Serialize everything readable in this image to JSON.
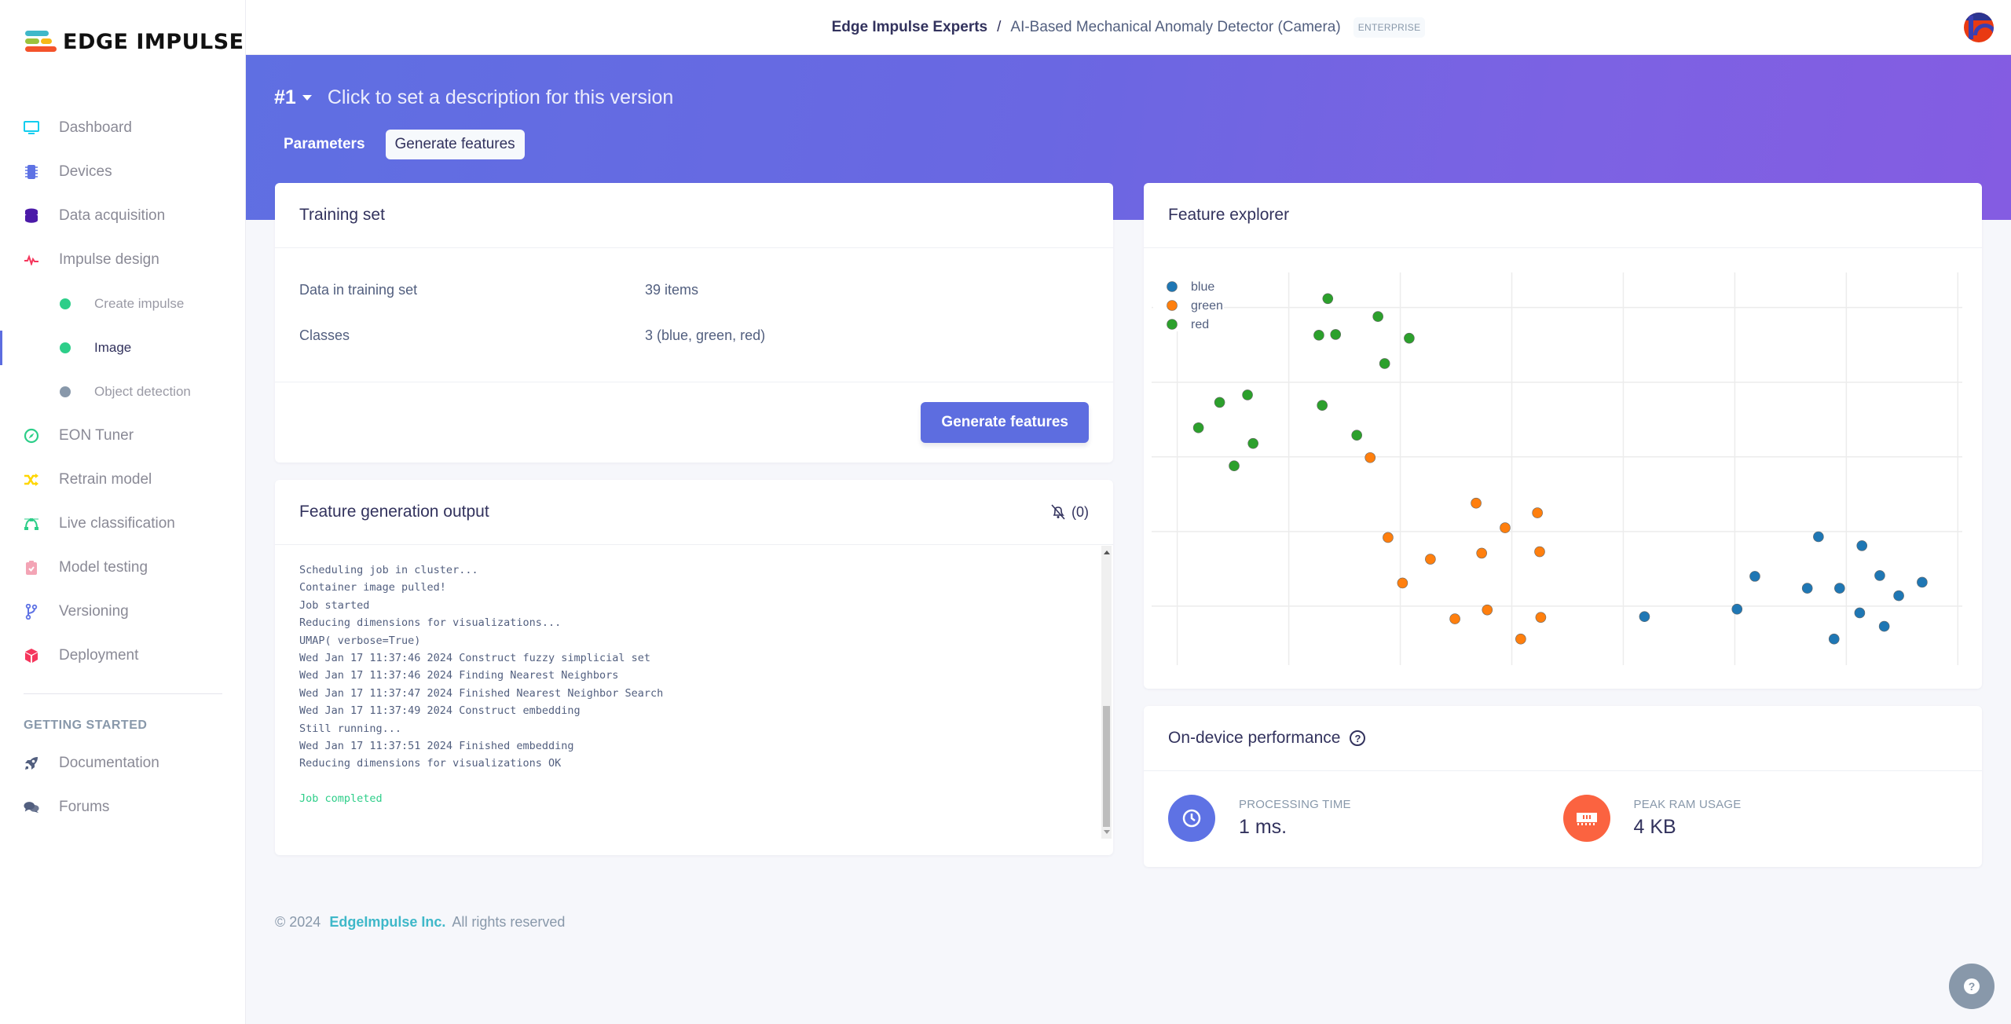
{
  "brand": {
    "name": "EDGE IMPULSE",
    "logo_colors": [
      "#3fb8c9",
      "#9bc23c",
      "#f6b918",
      "#f4532b"
    ]
  },
  "sidebar": {
    "items": [
      {
        "label": "Dashboard",
        "icon": "monitor-icon",
        "color": "#11cdef"
      },
      {
        "label": "Devices",
        "icon": "chip-icon",
        "color": "#5e72e4"
      },
      {
        "label": "Data acquisition",
        "icon": "database-icon",
        "color": "#4b1aa8"
      },
      {
        "label": "Impulse design",
        "icon": "pulse-icon",
        "color": "#f5365c"
      }
    ],
    "sub_items": [
      {
        "label": "Create impulse",
        "dot_color": "#2dce89",
        "active": false
      },
      {
        "label": "Image",
        "dot_color": "#2dce89",
        "active": true
      },
      {
        "label": "Object detection",
        "dot_color": "#8898aa",
        "active": false
      }
    ],
    "items2": [
      {
        "label": "EON Tuner",
        "icon": "compass-icon",
        "color": "#2dce89"
      },
      {
        "label": "Retrain model",
        "icon": "shuffle-icon",
        "color": "#ffd600"
      },
      {
        "label": "Live classification",
        "icon": "bezier-icon",
        "color": "#2dce89"
      },
      {
        "label": "Model testing",
        "icon": "clipboard-check-icon",
        "color": "#f3a4b5"
      },
      {
        "label": "Versioning",
        "icon": "branch-icon",
        "color": "#5e72e4"
      },
      {
        "label": "Deployment",
        "icon": "cube-icon",
        "color": "#f5365c"
      }
    ],
    "section_heading": "GETTING STARTED",
    "items3": [
      {
        "label": "Documentation",
        "icon": "rocket-icon",
        "color": "#525f7f"
      },
      {
        "label": "Forums",
        "icon": "comments-icon",
        "color": "#525f7f"
      }
    ]
  },
  "topbar": {
    "org": "Edge Impulse Experts",
    "separator": "/",
    "project": "AI-Based Mechanical Anomaly Detector (Camera)",
    "badge": "ENTERPRISE"
  },
  "banner": {
    "version": "#1",
    "description": "Click to set a description for this version",
    "tabs": [
      {
        "label": "Parameters",
        "active": false
      },
      {
        "label": "Generate features",
        "active": true
      }
    ]
  },
  "training_set": {
    "title": "Training set",
    "rows": [
      {
        "key": "Data in training set",
        "value": "39 items"
      },
      {
        "key": "Classes",
        "value": "3 (blue, green, red)"
      }
    ],
    "button": "Generate features"
  },
  "output": {
    "title": "Feature generation output",
    "notifications_count": "(0)",
    "log_lines": [
      "Scheduling job in cluster...",
      "Container image pulled!",
      "Job started",
      "Reducing dimensions for visualizations...",
      "UMAP( verbose=True)",
      "Wed Jan 17 11:37:46 2024 Construct fuzzy simplicial set",
      "Wed Jan 17 11:37:46 2024 Finding Nearest Neighbors",
      "Wed Jan 17 11:37:47 2024 Finished Nearest Neighbor Search",
      "Wed Jan 17 11:37:49 2024 Construct embedding",
      "Still running...",
      "Wed Jan 17 11:37:51 2024 Finished embedding",
      "Reducing dimensions for visualizations OK",
      ""
    ],
    "final_line": "Job completed"
  },
  "explorer": {
    "title": "Feature explorer"
  },
  "chart_data": {
    "type": "scatter",
    "title": "Feature explorer",
    "xlabel": "",
    "ylabel": "",
    "xlim": [
      -0.23,
      7.04
    ],
    "ylim": [
      0.21,
      5.47
    ],
    "grid": true,
    "x_gridlines": [
      0,
      1,
      2,
      3,
      4,
      5,
      6,
      7
    ],
    "y_gridlines": [
      1,
      2,
      3,
      4,
      5
    ],
    "legend_position": "top-left",
    "series": [
      {
        "name": "blue",
        "color": "#1f77b4",
        "points": [
          [
            5.75,
            1.93
          ],
          [
            6.14,
            1.81
          ],
          [
            5.18,
            1.4
          ],
          [
            6.3,
            1.41
          ],
          [
            5.65,
            1.24
          ],
          [
            5.94,
            1.24
          ],
          [
            6.68,
            1.32
          ],
          [
            6.47,
            1.14
          ],
          [
            5.02,
            0.96
          ],
          [
            4.19,
            0.86
          ],
          [
            6.12,
            0.91
          ],
          [
            6.34,
            0.73
          ],
          [
            5.89,
            0.56
          ]
        ]
      },
      {
        "name": "green",
        "color": "#ff7f0e",
        "points": [
          [
            1.73,
            2.99
          ],
          [
            2.68,
            2.38
          ],
          [
            3.23,
            2.25
          ],
          [
            2.94,
            2.05
          ],
          [
            1.89,
            1.92
          ],
          [
            2.27,
            1.63
          ],
          [
            2.73,
            1.71
          ],
          [
            3.25,
            1.73
          ],
          [
            2.02,
            1.31
          ],
          [
            2.78,
            0.95
          ],
          [
            2.49,
            0.83
          ],
          [
            3.26,
            0.85
          ],
          [
            3.08,
            0.56
          ]
        ]
      },
      {
        "name": "red",
        "color": "#2ca02c",
        "points": [
          [
            1.35,
            5.12
          ],
          [
            1.8,
            4.88
          ],
          [
            1.27,
            4.63
          ],
          [
            1.42,
            4.64
          ],
          [
            2.08,
            4.59
          ],
          [
            1.86,
            4.25
          ],
          [
            0.63,
            3.83
          ],
          [
            0.38,
            3.73
          ],
          [
            1.3,
            3.69
          ],
          [
            0.19,
            3.39
          ],
          [
            1.61,
            3.29
          ],
          [
            0.68,
            3.18
          ],
          [
            0.51,
            2.88
          ]
        ]
      }
    ]
  },
  "performance": {
    "title": "On-device performance",
    "metrics": [
      {
        "label": "PROCESSING TIME",
        "value": "1 ms.",
        "icon": "clock-icon",
        "color": "#5e72e4"
      },
      {
        "label": "PEAK RAM USAGE",
        "value": "4 KB",
        "icon": "memory-icon",
        "color": "#fb6340"
      }
    ]
  },
  "footer": {
    "copyright": "© 2024",
    "company": "EdgeImpulse Inc.",
    "rights": "All rights reserved"
  }
}
